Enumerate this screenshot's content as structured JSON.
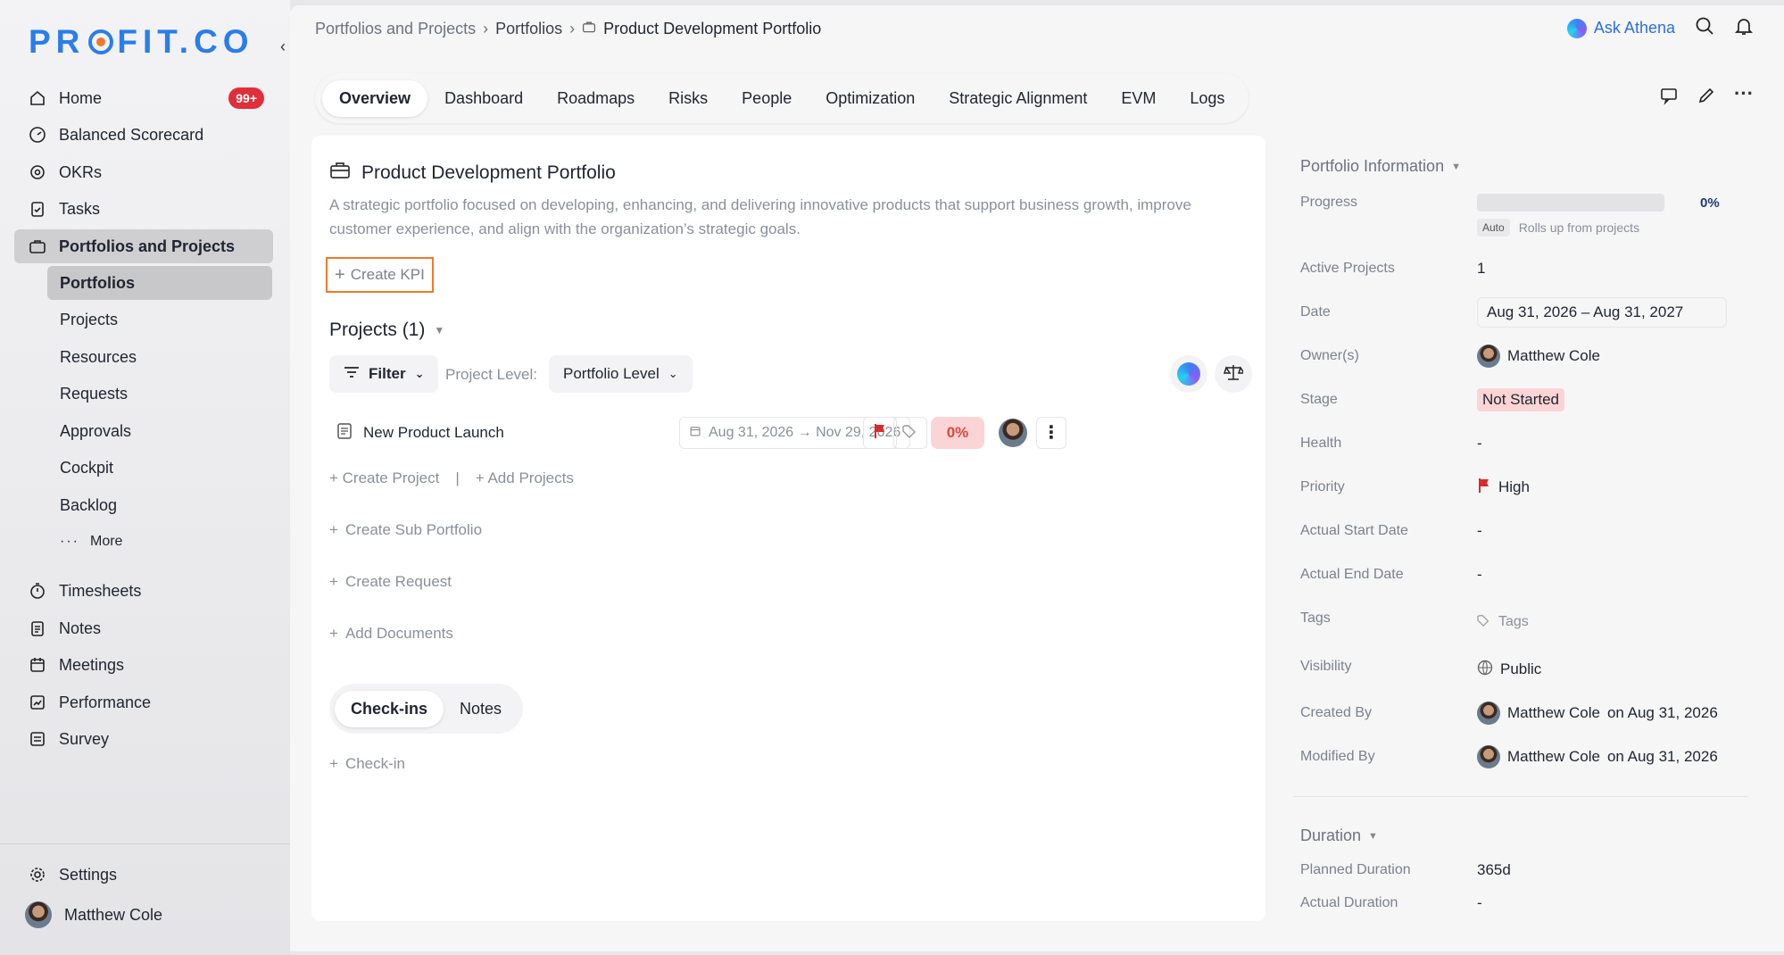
{
  "brand": {
    "logo": "PR⊙FIT.CO",
    "accent": "#2b7de9"
  },
  "sidebar": {
    "items": [
      {
        "label": "Home",
        "badge": "99+"
      },
      {
        "label": "Balanced Scorecard"
      },
      {
        "label": "OKRs"
      },
      {
        "label": "Tasks"
      },
      {
        "label": "Portfolios and Projects"
      }
    ],
    "sub_items": [
      "Portfolios",
      "Projects",
      "Resources",
      "Requests",
      "Approvals",
      "Cockpit",
      "Backlog",
      "More"
    ],
    "items2": [
      "Timesheets",
      "Notes",
      "Meetings",
      "Performance",
      "Survey"
    ],
    "settings": "Settings",
    "user": "Matthew Cole"
  },
  "breadcrumb": {
    "l1": "Portfolios and Projects",
    "l2": "Portfolios",
    "current": "Product Development Portfolio"
  },
  "header": {
    "ask": "Ask Athena"
  },
  "tabs": [
    "Overview",
    "Dashboard",
    "Roadmaps",
    "Risks",
    "People",
    "Optimization",
    "Strategic Alignment",
    "EVM",
    "Logs"
  ],
  "portfolio": {
    "title": "Product Development Portfolio",
    "description": "A strategic portfolio focused on developing, enhancing, and delivering innovative products that support business growth, improve customer experience, and align with the organization’s strategic goals.",
    "create_kpi": "Create KPI",
    "projects_label": "Projects (1)",
    "filter": "Filter",
    "project_level_label": "Project Level:",
    "project_level_value": "Portfolio Level",
    "project": {
      "name": "New Product Launch",
      "dates": "Aug 31, 2026 → Nov 29, 2026",
      "progress": "0%"
    },
    "create_project": "Create Project",
    "add_projects": "Add Projects",
    "create_sub_portfolio": "Create Sub Portfolio",
    "create_request": "Create Request",
    "add_documents": "Add Documents",
    "checkin_tabs": [
      "Check-ins",
      "Notes"
    ],
    "check_in": "Check-in"
  },
  "info": {
    "header": "Portfolio Information",
    "progress_label": "Progress",
    "progress_value": "0%",
    "progress_fraction": 0,
    "auto": "Auto",
    "rolls_up": "Rolls up from projects",
    "active_projects_label": "Active Projects",
    "active_projects": "1",
    "date_label": "Date",
    "date": "Aug 31, 2026 – Aug 31, 2027",
    "owners_label": "Owner(s)",
    "owner": "Matthew Cole",
    "stage_label": "Stage",
    "stage": "Not Started",
    "health_label": "Health",
    "health": "-",
    "priority_label": "Priority",
    "priority": "High",
    "actual_start_label": "Actual Start Date",
    "actual_start": "-",
    "actual_end_label": "Actual End Date",
    "actual_end": "-",
    "tags_label": "Tags",
    "tags": "Tags",
    "visibility_label": "Visibility",
    "visibility": "Public",
    "created_by_label": "Created By",
    "created_by": "Matthew Cole",
    "created_on": "on Aug 31, 2026",
    "modified_by_label": "Modified By",
    "modified_by": "Matthew Cole",
    "modified_on": "on Aug 31, 2026",
    "duration_header": "Duration",
    "planned_duration_label": "Planned Duration",
    "planned_duration": "365d",
    "actual_duration_label": "Actual Duration",
    "actual_duration": "-"
  }
}
